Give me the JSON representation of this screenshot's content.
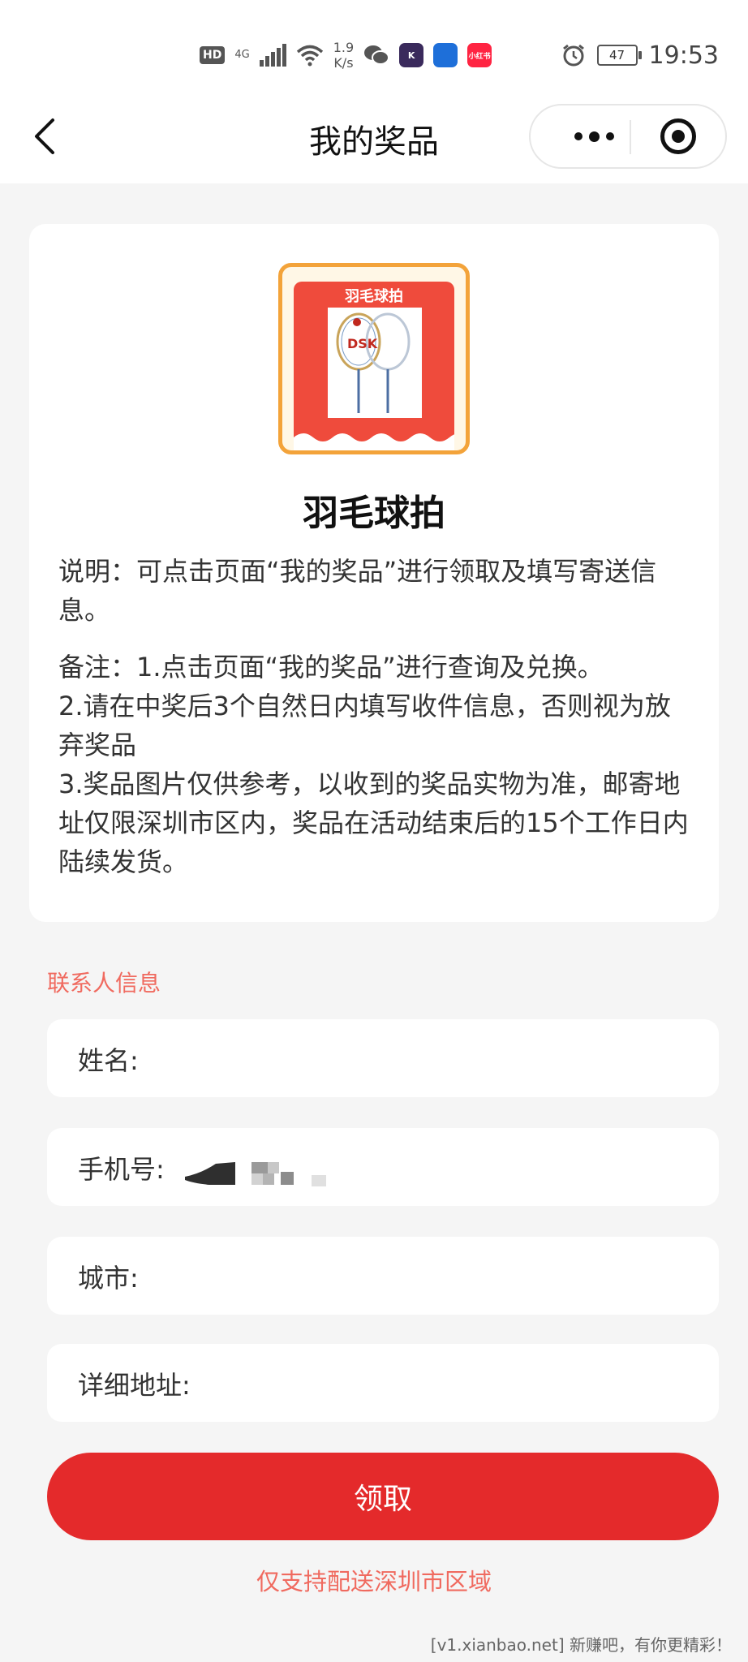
{
  "status_bar": {
    "hd": "HD",
    "network": "4G",
    "speed_value": "1.9",
    "speed_unit": "K/s",
    "app_icons": [
      {
        "name": "wechat-icon",
        "color": "#555555",
        "label": ""
      },
      {
        "name": "k-app-icon",
        "color": "#3a2a5c",
        "label": "K"
      },
      {
        "name": "blue-app-icon",
        "color": "#1e6fd9",
        "label": ""
      },
      {
        "name": "xiaohongshu-icon",
        "color": "#ff2442",
        "label": "小红书"
      }
    ],
    "battery": "47",
    "time": "19:53"
  },
  "nav": {
    "title": "我的奖品",
    "back_icon": "chevron-left-icon",
    "more_icon": "more-icon",
    "close_icon": "target-close-icon"
  },
  "prize": {
    "image_label": "羽毛球拍",
    "name": "羽毛球拍",
    "description": "说明：可点击页面“我的奖品”进行领取及填写寄送信息。",
    "notes": [
      "备注：1.点击页面“我的奖品”进行查询及兑换。",
      "2.请在中奖后3个自然日内填写收件信息，否则视为放弃奖品",
      "3.奖品图片仅供参考，以收到的奖品实物为准，邮寄地址仅限深圳市区内，奖品在活动结束后的15个工作日内陆续发货。"
    ]
  },
  "contact": {
    "section_label": "联系人信息",
    "fields": [
      {
        "label": "姓名:",
        "value": ""
      },
      {
        "label": "手机号:",
        "value": ""
      },
      {
        "label": "城市:",
        "value": ""
      },
      {
        "label": "详细地址:",
        "value": ""
      }
    ]
  },
  "actions": {
    "claim_label": "领取",
    "delivery_note": "仅支持配送深圳市区域"
  },
  "watermark": "[v1.xianbao.net] 新赚吧，有你更精彩！",
  "colors": {
    "accent": "#e42a2b",
    "label_red": "#f06a5f",
    "prize_border": "#f3a33a"
  }
}
